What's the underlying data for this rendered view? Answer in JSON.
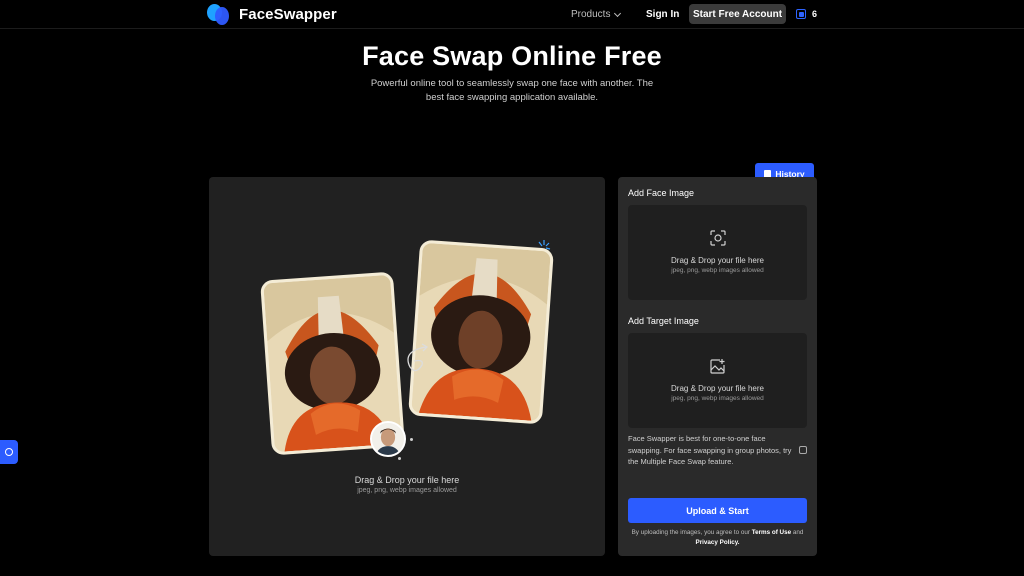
{
  "header": {
    "brand": "FaceSwapper",
    "nav_products": "Products",
    "sign_in": "Sign In",
    "start_free": "Start Free Account",
    "credits": "6"
  },
  "hero": {
    "title": "Face Swap Online Free",
    "subtitle": "Powerful online tool to seamlessly swap one face with another. The best face swapping application available."
  },
  "preview": {
    "drop_title": "Drag & Drop your file here",
    "drop_hint": "jpeg, png, webp images allowed"
  },
  "panel": {
    "history": "History",
    "face_label": "Add Face Image",
    "face_drop_title": "Drag & Drop your file here",
    "face_drop_hint": "jpeg, png, webp images allowed",
    "target_label": "Add Target Image",
    "target_drop_title": "Drag & Drop your file here",
    "target_drop_hint": "jpeg, png, webp images allowed",
    "info": "Face Swapper is best for one-to-one face swapping. For face swapping in group photos, try the Multiple Face Swap feature.",
    "upload": "Upload & Start",
    "terms_prefix": "By uploading the images, you agree to our",
    "terms_link": "Terms of Use",
    "terms_and": "and",
    "privacy_link": "Privacy Policy."
  },
  "colors": {
    "accent": "#2c5cff",
    "background": "#000000",
    "panel": "#2a2a2a",
    "dropzone": "#1f1f1f"
  },
  "icons": [
    "logo-icon",
    "chevron-down-icon",
    "credits-icon",
    "history-icon",
    "face-scan-icon",
    "image-add-icon",
    "external-link-icon",
    "feedback-icon",
    "sparkle-icon",
    "swap-arrow-icon"
  ]
}
